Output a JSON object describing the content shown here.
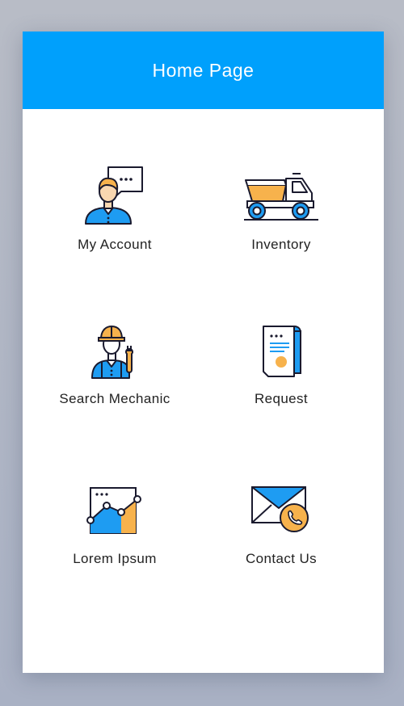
{
  "header": {
    "title": "Home Page"
  },
  "colors": {
    "header_bg": "#00a0fc",
    "accent_blue": "#1e9cf2",
    "accent_orange": "#f7b24c",
    "outline": "#1a1a2e"
  },
  "tiles": [
    {
      "label": "My Account",
      "icon": "user-chat-icon"
    },
    {
      "label": "Inventory",
      "icon": "dump-truck-icon"
    },
    {
      "label": "Search Mechanic",
      "icon": "mechanic-icon"
    },
    {
      "label": "Request",
      "icon": "request-document-icon"
    },
    {
      "label": "Lorem Ipsum",
      "icon": "area-chart-icon"
    },
    {
      "label": "Contact Us",
      "icon": "mail-phone-icon"
    }
  ]
}
